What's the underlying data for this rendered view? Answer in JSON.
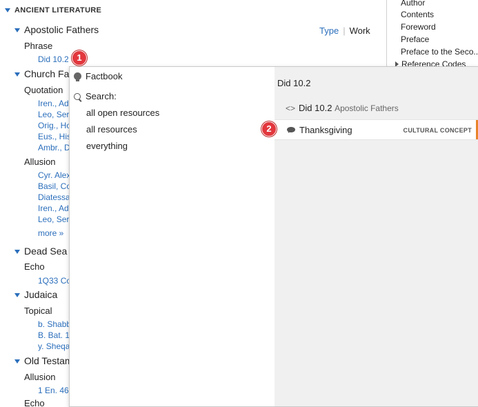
{
  "left": {
    "section_title": "ANCIENT LITERATURE",
    "type_label": "Type",
    "work_label": "Work",
    "groups": [
      {
        "title": "Apostolic Fathers",
        "sub": "Phrase",
        "links": [
          "Did 10.2"
        ]
      },
      {
        "title": "Church Fath",
        "subs": [
          {
            "label": "Quotation",
            "links": [
              "Iren., Ad",
              "Leo, Ser",
              "Orig., Ho",
              "Eus., His",
              "Ambr., D"
            ]
          },
          {
            "label": "Allusion",
            "links": [
              "Cyr. Alex",
              "Basil, Co",
              "Diatessa",
              "Iren., Adv",
              "Leo, Serr"
            ]
          }
        ],
        "more": "more »"
      },
      {
        "title": "Dead Sea Sc",
        "sub": "Echo",
        "links": [
          "1Q33 Co"
        ]
      },
      {
        "title": "Judaica",
        "sub": "Topical",
        "links": [
          "b. Shabb",
          "B. Bat. 1(",
          "y. Sheqa"
        ]
      },
      {
        "title": "Old Testam",
        "sub": "Allusion",
        "links": [
          "1 En. 46."
        ],
        "sub2": "Echo"
      }
    ]
  },
  "toc": {
    "items": [
      "Author",
      "Contents",
      "Foreword",
      "Preface",
      "Preface to the Seco...",
      "Reference Codes"
    ]
  },
  "popup": {
    "factbook_label": "Factbook",
    "search_label": "Search:",
    "search_options": [
      "all open resources",
      "all resources",
      "everything"
    ],
    "right_title": "Did 10.2",
    "crumb_ref": "Did 10.2",
    "crumb_resource": "Apostolic Fathers",
    "result_label": "Thanksgiving",
    "result_tag": "CULTURAL CONCEPT"
  },
  "badges": {
    "one": "1",
    "two": "2"
  },
  "colors": {
    "link": "#2a6ebb",
    "accent": "#e8832a",
    "badge": "#e2373d"
  }
}
